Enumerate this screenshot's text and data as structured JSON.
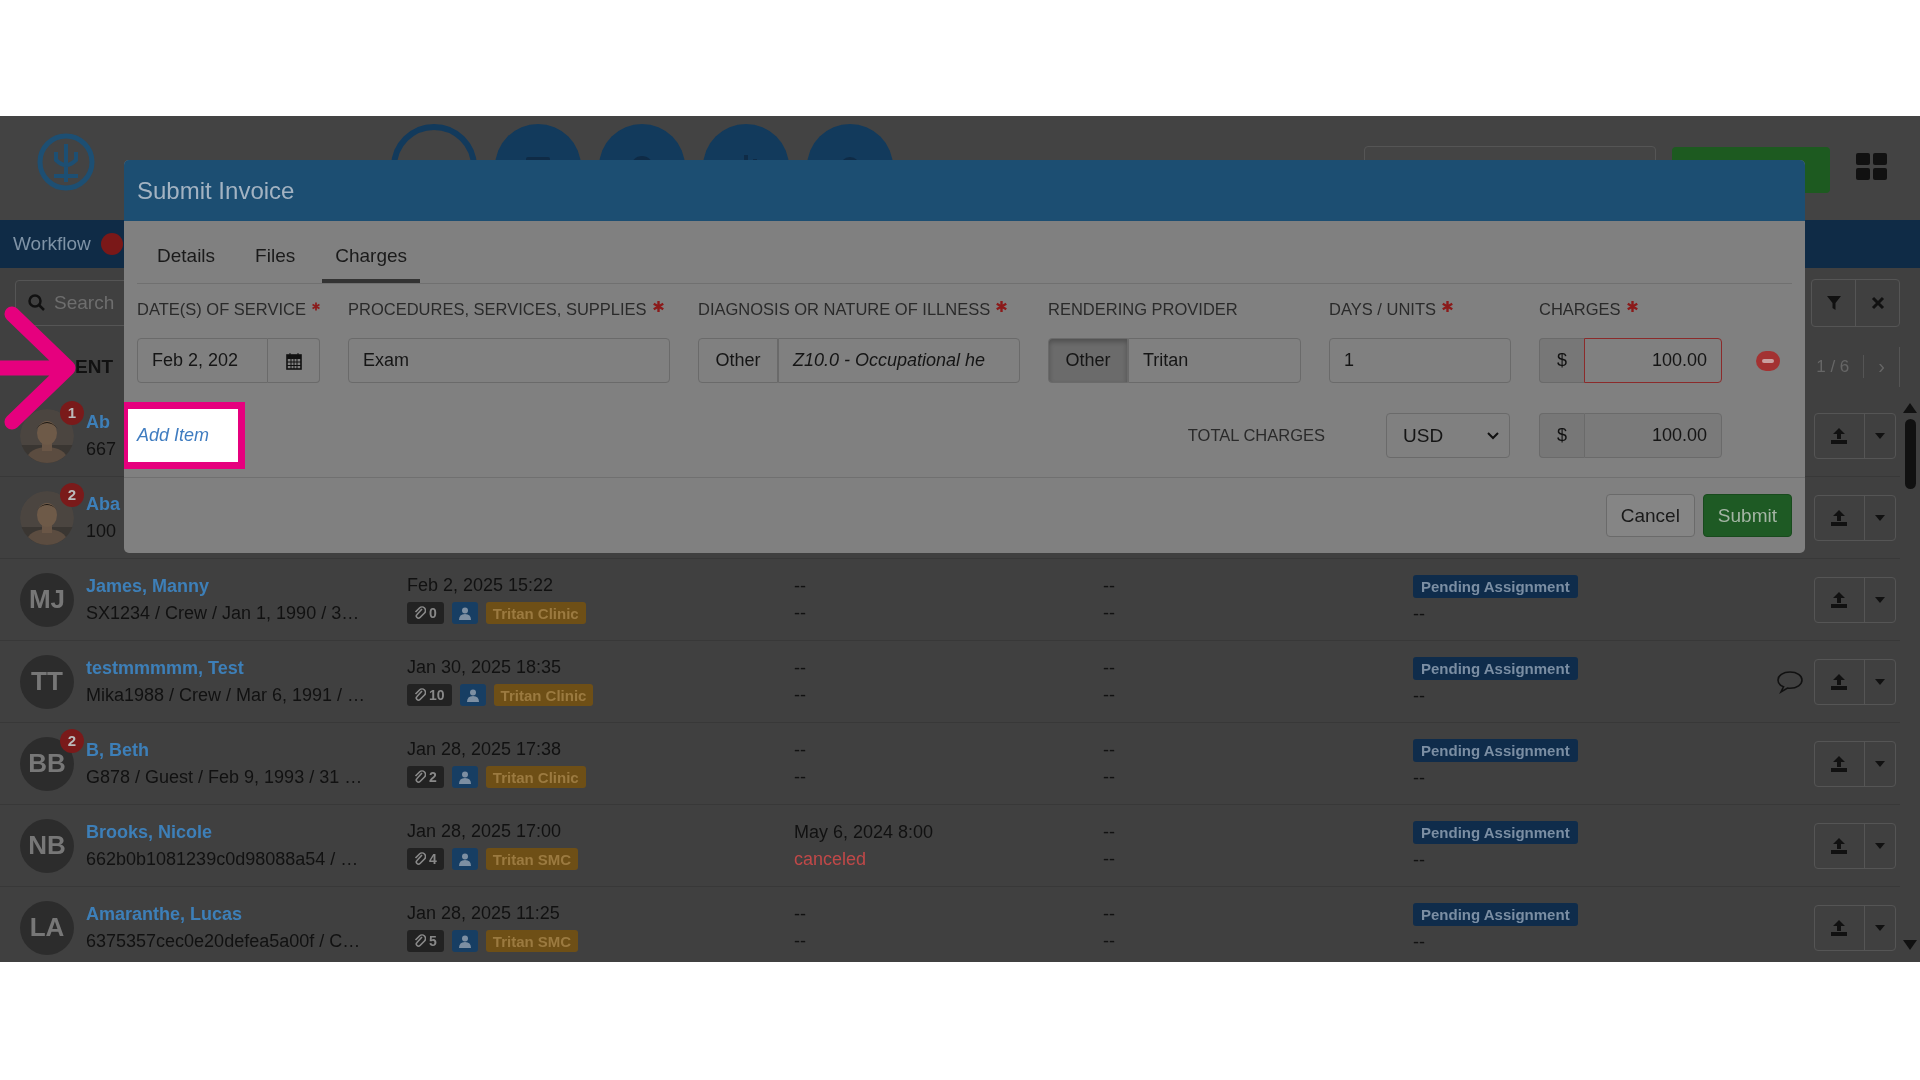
{
  "nav": {
    "label": "Workflow"
  },
  "search": {
    "placeholder": "Search"
  },
  "list": {
    "heading": "ENT",
    "pager": "1 / 6",
    "next": "›"
  },
  "rows": [
    {
      "badge": "1",
      "name": "Ab",
      "details": "667"
    },
    {
      "badge": "2",
      "name": "Aba",
      "details": "100"
    },
    {
      "initials": "MJ",
      "name": "James, Manny",
      "details": "SX1234 / Crew / Jan 1, 1990 / 3…",
      "date": "Feb 2, 2025 15:22",
      "attachments": "0",
      "clinic": "Tritan Clinic",
      "column_3": [
        {
          "text": "--",
          "kind": "plain"
        },
        {
          "text": "--",
          "kind": "plain"
        }
      ],
      "column_4": [
        "--",
        "--"
      ],
      "status": "Pending Assignment",
      "status_note": "--",
      "comment": false
    },
    {
      "initials": "TT",
      "name": "testmmmmm, Test",
      "details": "Mika1988 / Crew / Mar 6, 1991 / …",
      "date": "Jan 30, 2025 18:35",
      "attachments": "10",
      "clinic": "Tritan Clinic",
      "column_3": [
        {
          "text": "--",
          "kind": "plain"
        },
        {
          "text": "--",
          "kind": "plain"
        }
      ],
      "column_4": [
        "--",
        "--"
      ],
      "status": "Pending Assignment",
      "status_note": "--",
      "comment": true
    },
    {
      "initials": "BB",
      "badge": "2",
      "name": "B, Beth",
      "details": "G878 / Guest / Feb 9, 1993 / 31 …",
      "date": "Jan 28, 2025 17:38",
      "attachments": "2",
      "clinic": "Tritan Clinic",
      "column_3": [
        {
          "text": "--",
          "kind": "plain"
        },
        {
          "text": "--",
          "kind": "plain"
        }
      ],
      "column_4": [
        "--",
        "--"
      ],
      "status": "Pending Assignment",
      "status_note": "--",
      "comment": false
    },
    {
      "initials": "NB",
      "name": "Brooks, Nicole",
      "details": "662b0b1081239c0d98088a54 / …",
      "date": "Jan 28, 2025 17:00",
      "attachments": "4",
      "clinic": "Tritan SMC",
      "column_3": [
        {
          "text": "May 6, 2024 8:00",
          "kind": "plain"
        },
        {
          "text": "canceled",
          "kind": "canceled"
        }
      ],
      "column_4": [
        "--",
        "--"
      ],
      "status": "Pending Assignment",
      "status_note": "--",
      "comment": false
    },
    {
      "initials": "LA",
      "name": "Amaranthe, Lucas",
      "details": "6375357cec0e20defea5a00f / C…",
      "date": "Jan 28, 2025 11:25",
      "attachments": "5",
      "clinic": "Tritan SMC",
      "column_3": [
        {
          "text": "--",
          "kind": "plain"
        },
        {
          "text": "--",
          "kind": "plain"
        }
      ],
      "column_4": [
        "--",
        "--"
      ],
      "status": "Pending Assignment",
      "status_note": "--",
      "comment": false
    }
  ],
  "modal": {
    "title": "Submit Invoice",
    "tabs": [
      {
        "label": "Details",
        "selected": false
      },
      {
        "label": "Files",
        "selected": false
      },
      {
        "label": "Charges",
        "selected": true
      }
    ],
    "fields": [
      {
        "label": "DATE(S) OF SERVICE",
        "required": true,
        "kind": "date",
        "value": "Feb 2, 202",
        "invalid": false
      },
      {
        "label": "PROCEDURES, SERVICES, SUPPLIES",
        "required": true,
        "kind": "text",
        "value": "Exam",
        "invalid": false
      },
      {
        "label": "DIAGNOSIS OR NATURE OF ILLNESS",
        "required": true,
        "kind": "choice",
        "option": "Other",
        "option_selected": false,
        "italic": true,
        "value": "Z10.0 - Occupational he",
        "invalid": false
      },
      {
        "label": "RENDERING PROVIDER",
        "required": false,
        "kind": "choice",
        "option": "Other",
        "option_selected": true,
        "italic": false,
        "value": "Tritan",
        "invalid": false
      },
      {
        "label": "DAYS / UNITS",
        "required": true,
        "kind": "text",
        "value": "1",
        "invalid": false
      },
      {
        "label": "CHARGES",
        "required": true,
        "kind": "money",
        "prefix": "$",
        "value": "100.00",
        "invalid": true
      }
    ],
    "add_item": "Add Item",
    "total_label": "TOTAL CHARGES",
    "currency": "USD",
    "total_prefix": "$",
    "total": "100.00",
    "buttons": [
      {
        "label": "Cancel",
        "kind": "default"
      },
      {
        "label": "Submit",
        "kind": "primary"
      }
    ]
  }
}
